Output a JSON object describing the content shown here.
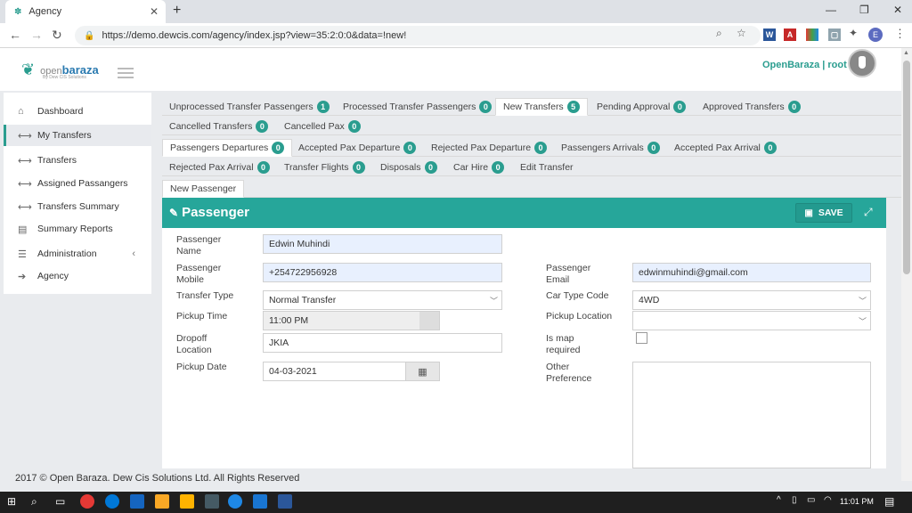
{
  "browser": {
    "tab_title": "Agency",
    "url": "https://demo.dewcis.com/agency/index.jsp?view=35:2:0:0&data=!new!",
    "profile_initial": "E"
  },
  "app": {
    "logo_open": "open",
    "logo_brand": "baraza",
    "logo_sub": "By Dew CIS Solutions",
    "user_label": "OpenBaraza | root"
  },
  "sidebar": {
    "items": [
      {
        "label": "Dashboard",
        "icon": "home-icon"
      },
      {
        "label": "My Transfers",
        "icon": "arrows-icon"
      },
      {
        "label": "Transfers",
        "icon": "arrows-icon"
      },
      {
        "label": "Assigned Passangers",
        "icon": "arrows-icon"
      },
      {
        "label": "Transfers Summary",
        "icon": "arrows-icon"
      },
      {
        "label": "Summary Reports",
        "icon": "pdf-icon"
      },
      {
        "label": "Administration",
        "icon": "list-icon"
      },
      {
        "label": "Agency",
        "icon": "arrow-right-icon"
      }
    ]
  },
  "tabs": {
    "row1": [
      {
        "label": "Unprocessed Transfer Passengers",
        "badge": "1"
      },
      {
        "label": "Processed Transfer Passengers",
        "badge": "0"
      },
      {
        "label": "New Transfers",
        "badge": "5"
      },
      {
        "label": "Pending Approval",
        "badge": "0"
      },
      {
        "label": "Approved Transfers",
        "badge": "0"
      }
    ],
    "row2": [
      {
        "label": "Cancelled Transfers",
        "badge": "0"
      },
      {
        "label": "Cancelled Pax",
        "badge": "0"
      }
    ],
    "row3": [
      {
        "label": "Passengers Departures",
        "badge": "0"
      },
      {
        "label": "Accepted Pax Departure",
        "badge": "0"
      },
      {
        "label": "Rejected Pax Departure",
        "badge": "0"
      },
      {
        "label": "Passengers Arrivals",
        "badge": "0"
      },
      {
        "label": "Accepted Pax Arrival",
        "badge": "0"
      }
    ],
    "row4": [
      {
        "label": "Rejected Pax Arrival",
        "badge": "0"
      },
      {
        "label": "Transfer Flights",
        "badge": "0"
      },
      {
        "label": "Disposals",
        "badge": "0"
      },
      {
        "label": "Car Hire",
        "badge": "0"
      },
      {
        "label": "Edit Transfer",
        "badge": ""
      }
    ],
    "row5": [
      {
        "label": "New Passenger"
      }
    ]
  },
  "panel": {
    "title": "Passenger",
    "save_label": "SAVE"
  },
  "form": {
    "passenger_name_label": "Passenger Name",
    "passenger_name": "Edwin Muhindi",
    "passenger_mobile_label": "Passenger Mobile",
    "passenger_mobile": "+254722956928",
    "passenger_email_label": "Passenger Email",
    "passenger_email": "edwinmuhindi@gmail.com",
    "transfer_type_label": "Transfer Type",
    "transfer_type": "Normal Transfer",
    "car_type_label": "Car Type Code",
    "car_type": "4WD",
    "pickup_time_label": "Pickup Time",
    "pickup_time": "11:00 PM",
    "pickup_location_label": "Pickup Location",
    "pickup_location": "",
    "dropoff_label": "Dropoff Location",
    "dropoff": "JKIA",
    "map_label": "Is map required",
    "pickup_date_label": "Pickup Date",
    "pickup_date": "04-03-2021",
    "other_pref_label": "Other Preference",
    "other_pref": ""
  },
  "footer": {
    "text": "2017 © Open Baraza. Dew Cis Solutions Ltd. All Rights Reserved"
  },
  "taskbar": {
    "time": "11:01 PM"
  },
  "colors": {
    "accent": "#26a69a",
    "badge": "#2a9d8f"
  }
}
